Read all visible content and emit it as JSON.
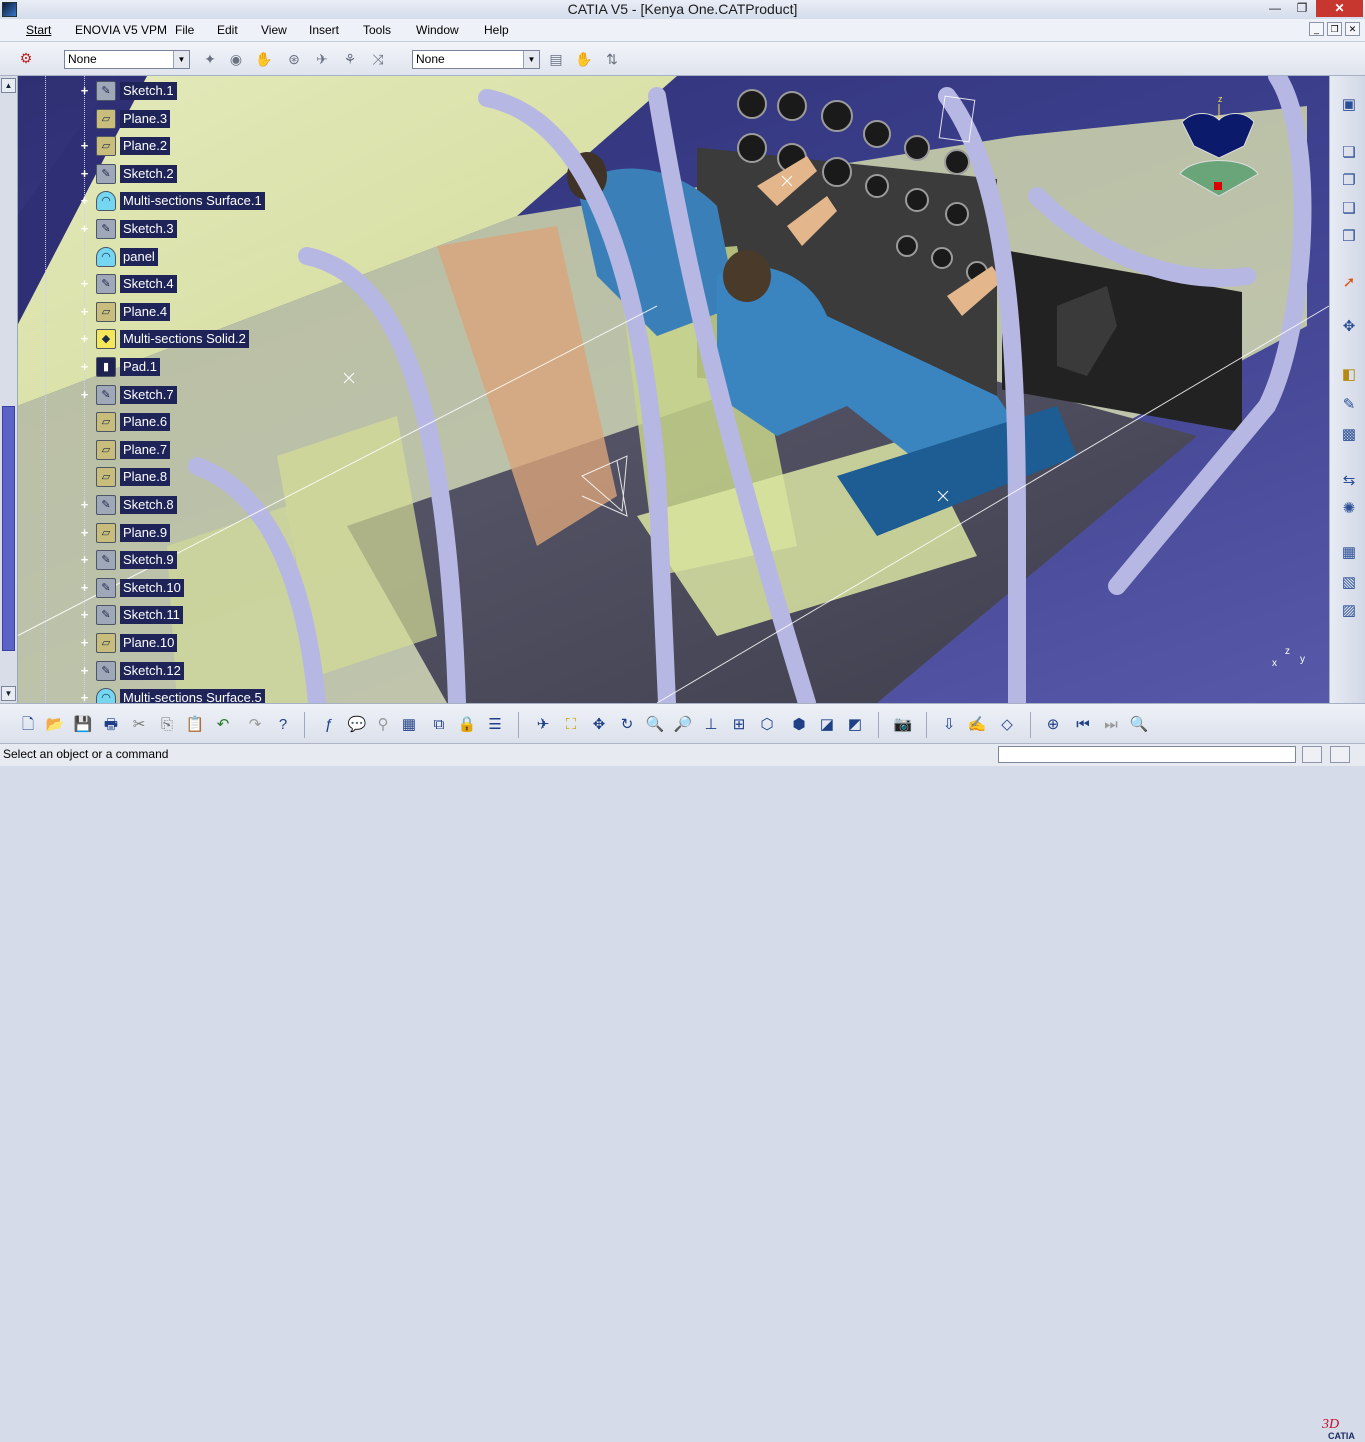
{
  "window": {
    "title": "CATIA V5 - [Kenya One.CATProduct]",
    "min_glyph": "—",
    "max_glyph": "❐",
    "close_glyph": "✕"
  },
  "menu": {
    "items": [
      "Start",
      "ENOVIA V5 VPM",
      "File",
      "Edit",
      "View",
      "Insert",
      "Tools",
      "Window",
      "Help"
    ],
    "mdi_min": "_",
    "mdi_restore": "❐",
    "mdi_close": "✕"
  },
  "toolbar": {
    "combo1_value": "None",
    "combo2_value": "None"
  },
  "tree": {
    "items": [
      {
        "label": "Sketch.1",
        "icon": "sketch-icon",
        "expander": "+"
      },
      {
        "label": "Plane.3",
        "icon": "plane-icon",
        "expander": ""
      },
      {
        "label": "Plane.2",
        "icon": "plane-icon",
        "expander": "+"
      },
      {
        "label": "Sketch.2",
        "icon": "sketch-icon",
        "expander": "+"
      },
      {
        "label": "Multi-sections Surface.1",
        "icon": "surface-icon",
        "expander": "+"
      },
      {
        "label": "Sketch.3",
        "icon": "sketch-icon",
        "expander": "+"
      },
      {
        "label": "panel",
        "icon": "surface-icon",
        "expander": ""
      },
      {
        "label": "Sketch.4",
        "icon": "sketch-icon",
        "expander": "+"
      },
      {
        "label": "Plane.4",
        "icon": "plane-icon",
        "expander": "+"
      },
      {
        "label": "Multi-sections Solid.2",
        "icon": "solid-icon",
        "expander": "+"
      },
      {
        "label": "Pad.1",
        "icon": "pad-icon",
        "expander": "+"
      },
      {
        "label": "Sketch.7",
        "icon": "sketch-icon",
        "expander": "+"
      },
      {
        "label": "Plane.6",
        "icon": "plane-icon",
        "expander": ""
      },
      {
        "label": "Plane.7",
        "icon": "plane-icon",
        "expander": ""
      },
      {
        "label": "Plane.8",
        "icon": "plane-icon",
        "expander": ""
      },
      {
        "label": "Sketch.8",
        "icon": "sketch-icon",
        "expander": "+"
      },
      {
        "label": "Plane.9",
        "icon": "plane-icon",
        "expander": "+"
      },
      {
        "label": "Sketch.9",
        "icon": "sketch-icon",
        "expander": "+"
      },
      {
        "label": "Sketch.10",
        "icon": "sketch-icon",
        "expander": "+"
      },
      {
        "label": "Sketch.11",
        "icon": "sketch-icon",
        "expander": "+"
      },
      {
        "label": "Plane.10",
        "icon": "plane-icon",
        "expander": "+"
      },
      {
        "label": "Sketch.12",
        "icon": "sketch-icon",
        "expander": "+"
      },
      {
        "label": "Multi-sections Surface.5",
        "icon": "surface-icon",
        "expander": "+"
      }
    ]
  },
  "compass": {
    "axis_label": "z"
  },
  "axis_triad": {
    "x": "x",
    "y": "y",
    "z": "z"
  },
  "status": {
    "message": "Select an object or a command"
  },
  "logo": {
    "brand": "CATIA"
  },
  "colors": {
    "tree_label_bg": "#1f2458",
    "viewport_bg": "#353a82",
    "hull": "#e6edb0",
    "frame": "#b9b9e6"
  }
}
